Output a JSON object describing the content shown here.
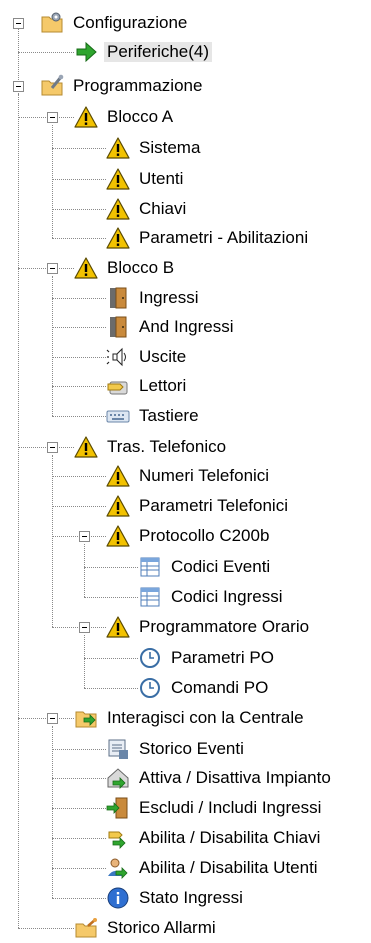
{
  "tree": [
    {
      "label": "Configurazione",
      "icon": "folder-gear-icon"
    },
    {
      "label": "Periferiche(4)",
      "icon": "green-arrow-icon",
      "selected": true
    },
    {
      "label": "Programmazione",
      "icon": "folder-wrench-icon"
    },
    {
      "label": "Blocco A",
      "icon": "warning-icon"
    },
    {
      "label": "Sistema",
      "icon": "warning-icon"
    },
    {
      "label": "Utenti",
      "icon": "warning-icon"
    },
    {
      "label": "Chiavi",
      "icon": "warning-icon"
    },
    {
      "label": "Parametri - Abilitazioni",
      "icon": "warning-icon"
    },
    {
      "label": "Blocco B",
      "icon": "warning-icon"
    },
    {
      "label": "Ingressi",
      "icon": "door-icon"
    },
    {
      "label": "And Ingressi",
      "icon": "door-icon"
    },
    {
      "label": "Uscite",
      "icon": "speaker-icon"
    },
    {
      "label": "Lettori",
      "icon": "key-reader-icon"
    },
    {
      "label": "Tastiere",
      "icon": "keyboard-icon"
    },
    {
      "label": "Tras. Telefonico",
      "icon": "warning-icon"
    },
    {
      "label": "Numeri Telefonici",
      "icon": "warning-icon"
    },
    {
      "label": "Parametri Telefonici",
      "icon": "warning-icon"
    },
    {
      "label": "Protocollo C200b",
      "icon": "warning-icon"
    },
    {
      "label": "Codici Eventi",
      "icon": "table-icon"
    },
    {
      "label": "Codici Ingressi",
      "icon": "table-icon"
    },
    {
      "label": "Programmatore Orario",
      "icon": "warning-icon"
    },
    {
      "label": "Parametri PO",
      "icon": "clock-icon"
    },
    {
      "label": "Comandi PO",
      "icon": "clock-icon"
    },
    {
      "label": "Interagisci con la Centrale",
      "icon": "folder-arrow-icon"
    },
    {
      "label": "Storico Eventi",
      "icon": "event-log-icon"
    },
    {
      "label": "Attiva / Disattiva Impianto",
      "icon": "house-arrow-icon"
    },
    {
      "label": "Escludi / Includi Ingressi",
      "icon": "door-arrow-icon"
    },
    {
      "label": "Abilita / Disabilita Chiavi",
      "icon": "key-arrow-icon"
    },
    {
      "label": "Abilita / Disabilita Utenti",
      "icon": "user-arrow-icon"
    },
    {
      "label": "Stato Ingressi",
      "icon": "info-icon"
    },
    {
      "label": "Storico Allarmi",
      "icon": "folder-alarm-icon"
    }
  ],
  "colors": {
    "warning": "#f2c200",
    "folder": "#f5c96a",
    "arrow": "#2fa52f",
    "selected_bg": "#e6e6e6"
  }
}
